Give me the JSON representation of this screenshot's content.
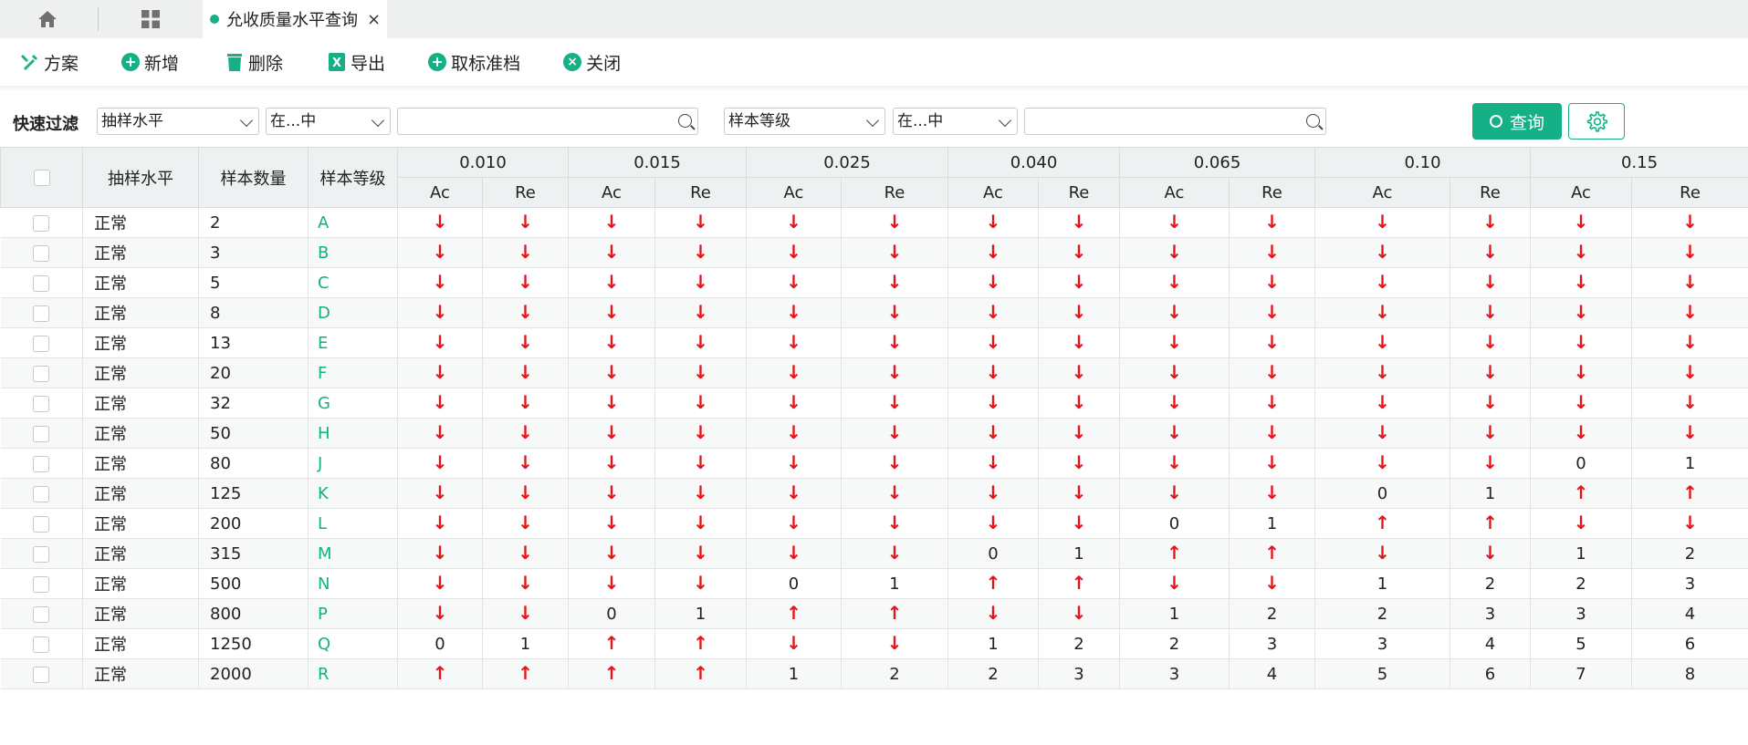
{
  "tabs": {
    "active_title": "允收质量水平查询",
    "close": "×"
  },
  "toolbar": {
    "items": [
      {
        "label": "方案",
        "icon": "scheme-icon"
      },
      {
        "label": "新增",
        "icon": "plus-circle-icon"
      },
      {
        "label": "删除",
        "icon": "trash-icon"
      },
      {
        "label": "导出",
        "icon": "excel-icon"
      },
      {
        "label": "取标准档",
        "icon": "plus-circle-icon"
      },
      {
        "label": "关闭",
        "icon": "close-circle-icon"
      }
    ]
  },
  "filter": {
    "label": "快速过滤",
    "field1": "抽样水平",
    "op1": "在...中",
    "field2": "样本等级",
    "op2": "在...中",
    "query_label": "查询"
  },
  "colors": {
    "accent": "#15b086",
    "arrow": "#e5141b"
  },
  "table": {
    "headers": {
      "level": "抽样水平",
      "size": "样本数量",
      "grade": "样本等级"
    },
    "aql": [
      "0.010",
      "0.015",
      "0.025",
      "0.040",
      "0.065",
      "0.10",
      "0.15"
    ],
    "sub": [
      "Ac",
      "Re"
    ],
    "arrow_down": "↓",
    "arrow_up": "↑",
    "rows": [
      {
        "level": "正常",
        "size": "2",
        "grade": "A",
        "cells": [
          "d",
          "d",
          "d",
          "d",
          "d",
          "d",
          "d",
          "d",
          "d",
          "d",
          "d",
          "d",
          "d",
          "d"
        ]
      },
      {
        "level": "正常",
        "size": "3",
        "grade": "B",
        "cells": [
          "d",
          "d",
          "d",
          "d",
          "d",
          "d",
          "d",
          "d",
          "d",
          "d",
          "d",
          "d",
          "d",
          "d"
        ]
      },
      {
        "level": "正常",
        "size": "5",
        "grade": "C",
        "cells": [
          "d",
          "d",
          "d",
          "d",
          "d",
          "d",
          "d",
          "d",
          "d",
          "d",
          "d",
          "d",
          "d",
          "d"
        ]
      },
      {
        "level": "正常",
        "size": "8",
        "grade": "D",
        "cells": [
          "d",
          "d",
          "d",
          "d",
          "d",
          "d",
          "d",
          "d",
          "d",
          "d",
          "d",
          "d",
          "d",
          "d"
        ]
      },
      {
        "level": "正常",
        "size": "13",
        "grade": "E",
        "cells": [
          "d",
          "d",
          "d",
          "d",
          "d",
          "d",
          "d",
          "d",
          "d",
          "d",
          "d",
          "d",
          "d",
          "d"
        ]
      },
      {
        "level": "正常",
        "size": "20",
        "grade": "F",
        "cells": [
          "d",
          "d",
          "d",
          "d",
          "d",
          "d",
          "d",
          "d",
          "d",
          "d",
          "d",
          "d",
          "d",
          "d"
        ]
      },
      {
        "level": "正常",
        "size": "32",
        "grade": "G",
        "cells": [
          "d",
          "d",
          "d",
          "d",
          "d",
          "d",
          "d",
          "d",
          "d",
          "d",
          "d",
          "d",
          "d",
          "d"
        ]
      },
      {
        "level": "正常",
        "size": "50",
        "grade": "H",
        "cells": [
          "d",
          "d",
          "d",
          "d",
          "d",
          "d",
          "d",
          "d",
          "d",
          "d",
          "d",
          "d",
          "d",
          "d"
        ]
      },
      {
        "level": "正常",
        "size": "80",
        "grade": "J",
        "cells": [
          "d",
          "d",
          "d",
          "d",
          "d",
          "d",
          "d",
          "d",
          "d",
          "d",
          "d",
          "d",
          "0",
          "1"
        ]
      },
      {
        "level": "正常",
        "size": "125",
        "grade": "K",
        "cells": [
          "d",
          "d",
          "d",
          "d",
          "d",
          "d",
          "d",
          "d",
          "d",
          "d",
          "0",
          "1",
          "u",
          "u"
        ]
      },
      {
        "level": "正常",
        "size": "200",
        "grade": "L",
        "cells": [
          "d",
          "d",
          "d",
          "d",
          "d",
          "d",
          "d",
          "d",
          "0",
          "1",
          "u",
          "u",
          "d",
          "d"
        ]
      },
      {
        "level": "正常",
        "size": "315",
        "grade": "M",
        "cells": [
          "d",
          "d",
          "d",
          "d",
          "d",
          "d",
          "0",
          "1",
          "u",
          "u",
          "d",
          "d",
          "1",
          "2"
        ]
      },
      {
        "level": "正常",
        "size": "500",
        "grade": "N",
        "cells": [
          "d",
          "d",
          "d",
          "d",
          "0",
          "1",
          "u",
          "u",
          "d",
          "d",
          "1",
          "2",
          "2",
          "3"
        ]
      },
      {
        "level": "正常",
        "size": "800",
        "grade": "P",
        "cells": [
          "d",
          "d",
          "0",
          "1",
          "u",
          "u",
          "d",
          "d",
          "1",
          "2",
          "2",
          "3",
          "3",
          "4"
        ]
      },
      {
        "level": "正常",
        "size": "1250",
        "grade": "Q",
        "cells": [
          "0",
          "1",
          "u",
          "u",
          "d",
          "d",
          "1",
          "2",
          "2",
          "3",
          "3",
          "4",
          "5",
          "6"
        ]
      },
      {
        "level": "正常",
        "size": "2000",
        "grade": "R",
        "cells": [
          "u",
          "u",
          "u",
          "u",
          "1",
          "2",
          "2",
          "3",
          "3",
          "4",
          "5",
          "6",
          "7",
          "8"
        ]
      }
    ]
  }
}
